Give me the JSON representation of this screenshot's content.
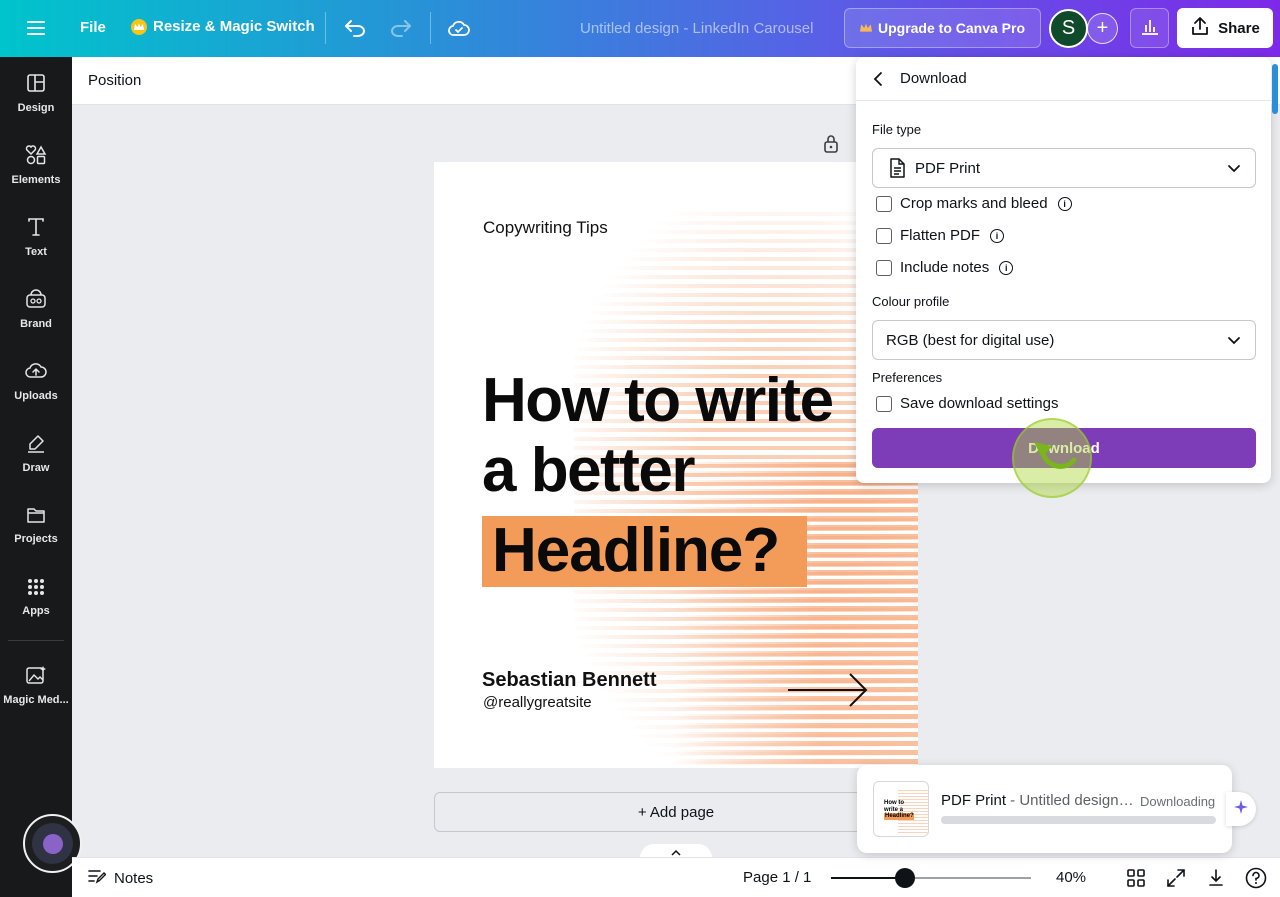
{
  "topbar": {
    "file_label": "File",
    "resize_label": "Resize & Magic Switch",
    "doc_title": "Untitled design - LinkedIn Carousel",
    "upgrade_label": "Upgrade to Canva Pro",
    "avatar_initial": "S",
    "share_label": "Share"
  },
  "sidebar": {
    "items": [
      {
        "label": "Design",
        "icon": "design-icon"
      },
      {
        "label": "Elements",
        "icon": "elements-icon"
      },
      {
        "label": "Text",
        "icon": "text-icon"
      },
      {
        "label": "Brand",
        "icon": "brand-icon"
      },
      {
        "label": "Uploads",
        "icon": "uploads-icon"
      },
      {
        "label": "Draw",
        "icon": "draw-icon"
      },
      {
        "label": "Projects",
        "icon": "folder-icon"
      },
      {
        "label": "Apps",
        "icon": "apps-grid-icon"
      },
      {
        "label": "Magic Med...",
        "icon": "magic-media-icon"
      }
    ]
  },
  "context_toolbar": {
    "position_label": "Position"
  },
  "page": {
    "kicker": "Copywriting Tips",
    "title_line1": "How to write",
    "title_line2": "a better",
    "highlight": "Headline?",
    "author": "Sebastian Bennett",
    "handle": "@reallygreatsite",
    "accent_color": "#f39b59"
  },
  "add_page_label": "+ Add page",
  "download_panel": {
    "title": "Download",
    "file_type_label": "File type",
    "file_type_value": "PDF Print",
    "options": [
      {
        "label": "Crop marks and bleed",
        "checked": false
      },
      {
        "label": "Flatten PDF",
        "checked": false
      },
      {
        "label": "Include notes",
        "checked": false
      }
    ],
    "colour_profile_label": "Colour profile",
    "colour_profile_value": "RGB (best for digital use)",
    "preferences_label": "Preferences",
    "save_settings_label": "Save download settings",
    "download_button": "Download",
    "button_color": "#7d3cb8"
  },
  "toast": {
    "file_type": "PDF Print",
    "file_name": " - Untitled design…",
    "status": "Downloading",
    "thumb_title": "How to write a better",
    "thumb_highlight": "Headline?"
  },
  "bottombar": {
    "notes_label": "Notes",
    "page_indicator": "Page 1 / 1",
    "zoom_label": "40%",
    "zoom_fraction": 0.37
  }
}
